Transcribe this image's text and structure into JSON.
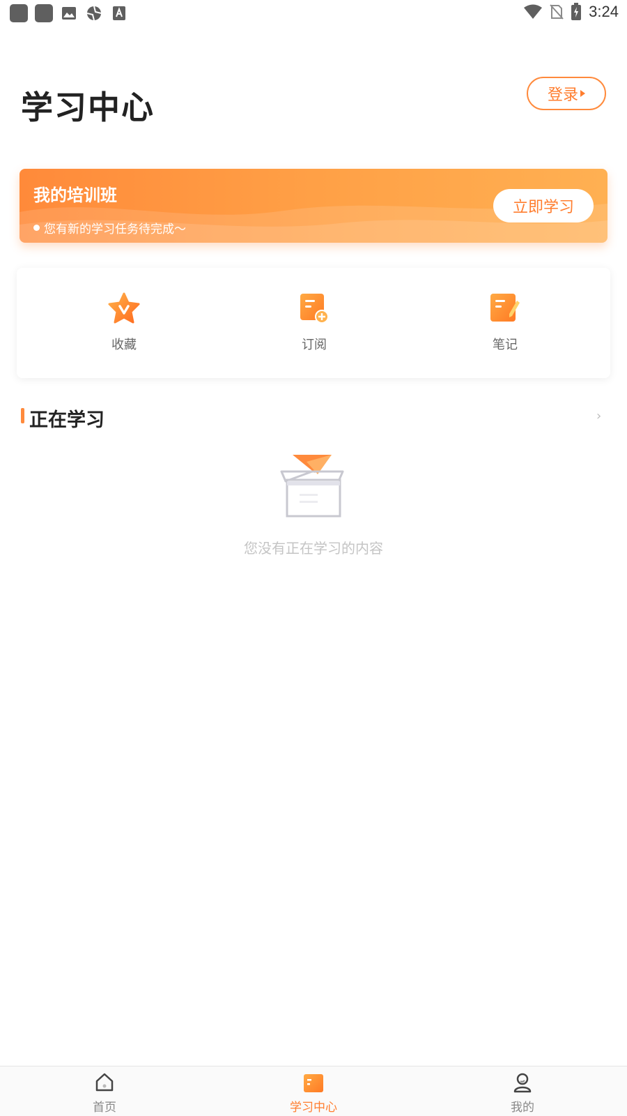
{
  "status_bar": {
    "time": "3:24"
  },
  "header": {
    "title": "学习中心",
    "login_label": "登录"
  },
  "banner": {
    "title": "我的培训班",
    "subtitle": "您有新的学习任务待完成～",
    "button_label": "立即学习"
  },
  "tools": [
    {
      "label": "收藏",
      "icon": "star-v-icon"
    },
    {
      "label": "订阅",
      "icon": "document-plus-icon"
    },
    {
      "label": "笔记",
      "icon": "note-pencil-icon"
    }
  ],
  "section": {
    "title": "正在学习",
    "more": "›"
  },
  "empty": {
    "text": "您没有正在学习的内容"
  },
  "tabbar": [
    {
      "label": "首页",
      "icon": "home-icon",
      "active": false
    },
    {
      "label": "学习中心",
      "icon": "study-center-icon",
      "active": true
    },
    {
      "label": "我的",
      "icon": "profile-icon",
      "active": false
    }
  ],
  "colors": {
    "accent": "#ff7d2e",
    "banner_start": "#ff8a3a",
    "banner_end": "#ffb052"
  }
}
